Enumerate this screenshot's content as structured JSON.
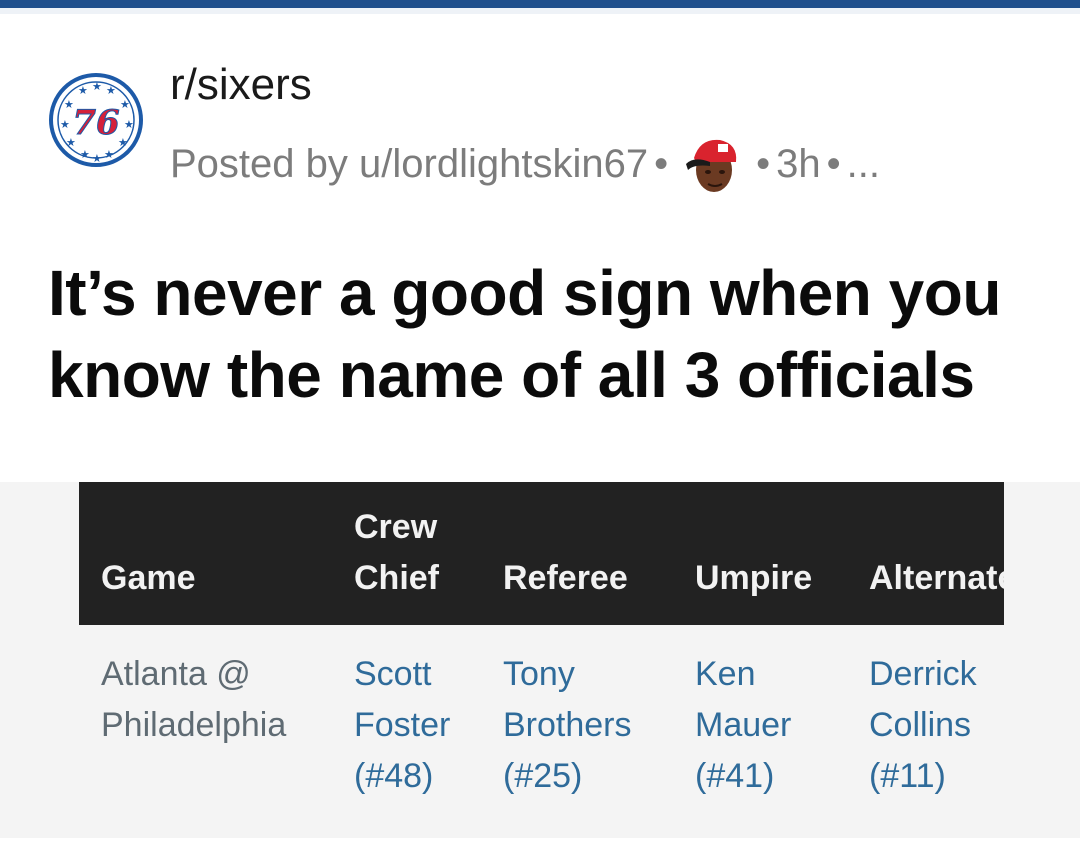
{
  "colors": {
    "top_bar": "#1f4f8c",
    "link": "#2f6b9a",
    "header_bg": "#222222",
    "meta": "#7c7c7c"
  },
  "post": {
    "subreddit": "r/sixers",
    "posted_by": "Posted by u/lordlightskin67",
    "time": "3h",
    "more": "...",
    "title": "It’s never a good sign when you know the name of all 3 officials"
  },
  "icons": {
    "subreddit": "sixers-76-logo-icon",
    "flair": "user-flair-avatar-icon"
  },
  "table": {
    "headers": {
      "game": "Game",
      "crew_chief": "Crew Chief",
      "referee": "Referee",
      "umpire": "Umpire",
      "alternate": "Alternate"
    },
    "row": {
      "game": "Atlanta @ Philadelphia",
      "crew_chief": "Scott Foster (#48)",
      "referee": "Tony Brothers (#25)",
      "umpire": "Ken Mauer (#41)",
      "alternate": "Derrick Collins (#11)"
    }
  }
}
